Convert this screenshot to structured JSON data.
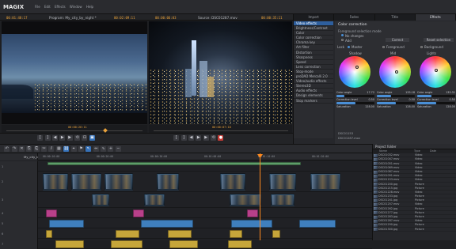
{
  "app": {
    "logo": "MAGIX",
    "menu": [
      "File",
      "Edit",
      "Effects",
      "Window",
      "Help"
    ]
  },
  "program": {
    "timecode_left": "00:01:48:17",
    "title": "Program: My_city_by_night *",
    "timecode_right": "00:02:09:11",
    "scrub_time": "00:00:26:11"
  },
  "source": {
    "timecode_left": "00:00:06:03",
    "title": "Source: DSC01287.mov",
    "timecode_right": "00:00:35:11",
    "scrub_time": "00:00:07:10"
  },
  "right_tabs": [
    "Import",
    "Fades",
    "Title",
    "Effects"
  ],
  "effects": {
    "list": [
      "Video effects",
      "Brightness/Contrast",
      "Color",
      "Color correction",
      "Chroma key",
      "Art filter",
      "Distortion",
      "Sharpness",
      "Speed",
      "Lens correction",
      "Stop-mode",
      "proDAD Mercalli 2.0",
      "Video/audio effects",
      "Stereo3D",
      "Audio effects",
      "Design elements",
      "Stop markers"
    ],
    "selected_index": 0,
    "panel_title": "Color correction",
    "foreground_mode_label": "Foreground selection mode",
    "no_changes_label": "No changes",
    "add_label": "Add",
    "correct_label": "Correct",
    "reset_label": "Reset selection",
    "lock_label": "Lock",
    "master_label": "Master",
    "foreground_label": "Foreground",
    "background_label": "Background",
    "wheels": [
      {
        "name": "Shadow",
        "angle_label": "Color angle",
        "angle": "17.72",
        "level_label": "Correction level",
        "level": "0.50",
        "sat_label": "Saturation",
        "sat": "128.00"
      },
      {
        "name": "Mid",
        "angle_label": "Color angle",
        "angle": "135.18",
        "level_label": "Correction level",
        "level": "0.50",
        "sat_label": "Saturation",
        "sat": "128.00"
      },
      {
        "name": "Lights",
        "angle_label": "Color angle",
        "angle": "135.31",
        "level_label": "Correction level",
        "level": "0.50",
        "sat_label": "Saturation",
        "sat": "128.00"
      }
    ],
    "footer_label": "DSC01153",
    "footer_file": "DSC01287.mov"
  },
  "timeline": {
    "sequence_name": "My_city_by_night",
    "ruler_marks": [
      "00:00:10:00",
      "00:00:20:00",
      "00:00:30:00",
      "00:01:00:00",
      "00:01:10:00",
      "00:01:20:00"
    ],
    "track_labels": [
      "1",
      "2",
      "3",
      "4",
      "5",
      "6",
      "7"
    ]
  },
  "project": {
    "title": "Project folder",
    "columns": [
      "Name",
      "Type",
      "Date"
    ],
    "rows": [
      {
        "name": "DSC01032.mov",
        "type": "Video"
      },
      {
        "name": "DSC01047.mov",
        "type": "Video"
      },
      {
        "name": "DSC01051.mov",
        "type": "Video"
      },
      {
        "name": "DSC01069.mov",
        "type": "Video"
      },
      {
        "name": "DSC01087.mov",
        "type": "Video"
      },
      {
        "name": "DSC01091.mov",
        "type": "Video"
      },
      {
        "name": "DSC01153.mov",
        "type": "Video"
      },
      {
        "name": "DSC01200.jpg",
        "type": "Picture"
      },
      {
        "name": "DSC01215.jpg",
        "type": "Picture"
      },
      {
        "name": "DSC01228.mov",
        "type": "Video"
      },
      {
        "name": "DSC01233.jpg",
        "type": "Picture"
      },
      {
        "name": "DSC01241.jpg",
        "type": "Picture"
      },
      {
        "name": "DSC01257.mov",
        "type": "Video"
      },
      {
        "name": "DSC01262.jpg",
        "type": "Picture"
      },
      {
        "name": "DSC01277.jpg",
        "type": "Picture"
      },
      {
        "name": "DSC01283.jpg",
        "type": "Picture"
      },
      {
        "name": "DSC01287.mov",
        "type": "Video"
      },
      {
        "name": "DSC01290.jpg",
        "type": "Picture"
      },
      {
        "name": "DSC01300.jpg",
        "type": "Picture"
      }
    ]
  },
  "colors": {
    "accent": "#3571b8",
    "timecode": "#e9a23b",
    "playhead": "#ff8a1e"
  }
}
